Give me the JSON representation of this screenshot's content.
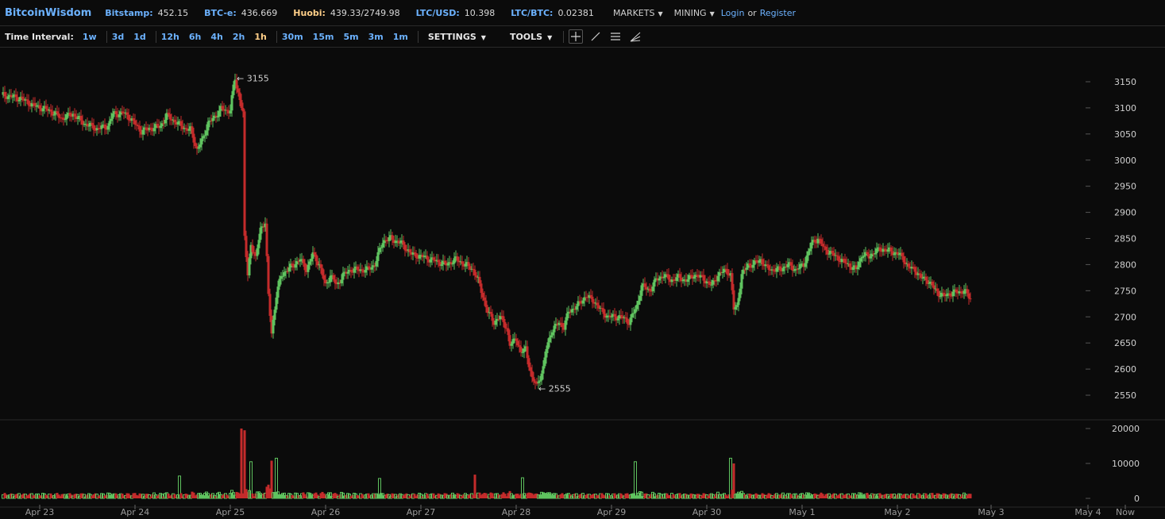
{
  "header": {
    "brand": "BitcoinWisdom",
    "tickers": [
      {
        "name": "Bitstamp:",
        "value": "452.15"
      },
      {
        "name": "BTC-e:",
        "value": "436.669"
      },
      {
        "name": "Huobi:",
        "value": "439.33/2749.98"
      },
      {
        "name": "LTC/USD:",
        "value": "10.398"
      },
      {
        "name": "LTC/BTC:",
        "value": "0.02381"
      }
    ],
    "markets_label": "MARKETS",
    "mining_label": "MINING",
    "login_label": "Login",
    "or_label": "or",
    "register_label": "Register"
  },
  "toolbar": {
    "time_interval_label": "Time Interval:",
    "intervals": [
      "1w",
      "3d",
      "1d",
      "12h",
      "6h",
      "4h",
      "2h",
      "1h",
      "30m",
      "15m",
      "5m",
      "3m",
      "1m"
    ],
    "active_interval": "1h",
    "settings_label": "SETTINGS",
    "tools_label": "TOOLS",
    "tool_icons": [
      "crosshair-icon",
      "line-draw-icon",
      "horizontal-lines-icon",
      "fan-draw-icon"
    ]
  },
  "colors": {
    "up": "#5fc35f",
    "down": "#c42b2b",
    "accent": "#6cb2ff",
    "highlight": "#ffcf88",
    "grid_text": "#cfcfcf"
  },
  "chart_data": {
    "type": "candlestick",
    "price_axis": {
      "ticks": [
        3150,
        3100,
        3050,
        3000,
        2950,
        2900,
        2850,
        2800,
        2750,
        2700,
        2650,
        2600,
        2550
      ],
      "range": [
        2535,
        3175
      ]
    },
    "volume_axis": {
      "ticks": [
        20000,
        10000,
        0
      ],
      "range": [
        0,
        20000
      ]
    },
    "x_labels": [
      "Apr 23",
      "Apr 24",
      "Apr 25",
      "Apr 26",
      "Apr 27",
      "Apr 28",
      "Apr 29",
      "Apr 30",
      "May 1",
      "May 2",
      "May 3",
      "May 4",
      "Now"
    ],
    "max_marker": {
      "label": "3155",
      "value": 3155
    },
    "min_marker": {
      "label": "2555",
      "value": 2555
    },
    "price_path": [
      [
        0,
        3125
      ],
      [
        12,
        3118
      ],
      [
        20,
        3105
      ],
      [
        30,
        3095
      ],
      [
        38,
        3080
      ],
      [
        45,
        3088
      ],
      [
        52,
        3070
      ],
      [
        60,
        3060
      ],
      [
        67,
        3065
      ],
      [
        70,
        3088
      ],
      [
        77,
        3090
      ],
      [
        81,
        3080
      ],
      [
        88,
        3055
      ],
      [
        93,
        3060
      ],
      [
        100,
        3065
      ],
      [
        104,
        3085
      ],
      [
        110,
        3072
      ],
      [
        116,
        3060
      ],
      [
        119,
        3058
      ],
      [
        123,
        3020
      ],
      [
        127,
        3042
      ],
      [
        130,
        3072
      ],
      [
        134,
        3080
      ],
      [
        138,
        3100
      ],
      [
        141,
        3092
      ],
      [
        144,
        3098
      ],
      [
        146,
        3142
      ],
      [
        147,
        3155
      ],
      [
        148,
        3135
      ],
      [
        150,
        3120
      ],
      [
        152,
        3090
      ],
      [
        153,
        2850
      ],
      [
        155,
        2780
      ],
      [
        157,
        2840
      ],
      [
        160,
        2810
      ],
      [
        163,
        2870
      ],
      [
        166,
        2880
      ],
      [
        168,
        2740
      ],
      [
        170,
        2670
      ],
      [
        173,
        2740
      ],
      [
        176,
        2780
      ],
      [
        180,
        2790
      ],
      [
        184,
        2800
      ],
      [
        188,
        2810
      ],
      [
        192,
        2790
      ],
      [
        196,
        2820
      ],
      [
        200,
        2800
      ],
      [
        204,
        2760
      ],
      [
        207,
        2780
      ],
      [
        211,
        2760
      ],
      [
        215,
        2780
      ],
      [
        220,
        2790
      ],
      [
        225,
        2790
      ],
      [
        230,
        2790
      ],
      [
        235,
        2800
      ],
      [
        240,
        2845
      ],
      [
        245,
        2850
      ],
      [
        252,
        2840
      ],
      [
        258,
        2820
      ],
      [
        265,
        2815
      ],
      [
        270,
        2810
      ],
      [
        275,
        2805
      ],
      [
        280,
        2800
      ],
      [
        286,
        2810
      ],
      [
        292,
        2800
      ],
      [
        297,
        2790
      ],
      [
        300,
        2770
      ],
      [
        303,
        2740
      ],
      [
        306,
        2710
      ],
      [
        310,
        2690
      ],
      [
        314,
        2700
      ],
      [
        318,
        2680
      ],
      [
        320,
        2645
      ],
      [
        324,
        2660
      ],
      [
        327,
        2630
      ],
      [
        330,
        2640
      ],
      [
        334,
        2580
      ],
      [
        337,
        2570
      ],
      [
        341,
        2600
      ],
      [
        343,
        2640
      ],
      [
        346,
        2670
      ],
      [
        351,
        2690
      ],
      [
        354,
        2680
      ],
      [
        357,
        2710
      ],
      [
        362,
        2720
      ],
      [
        368,
        2740
      ],
      [
        373,
        2730
      ],
      [
        378,
        2710
      ],
      [
        382,
        2700
      ],
      [
        386,
        2700
      ],
      [
        390,
        2700
      ],
      [
        395,
        2690
      ],
      [
        400,
        2720
      ],
      [
        403,
        2760
      ],
      [
        408,
        2750
      ],
      [
        412,
        2770
      ],
      [
        417,
        2780
      ],
      [
        421,
        2770
      ],
      [
        426,
        2775
      ],
      [
        431,
        2770
      ],
      [
        436,
        2780
      ],
      [
        441,
        2775
      ],
      [
        447,
        2760
      ],
      [
        451,
        2780
      ],
      [
        456,
        2790
      ],
      [
        459,
        2780
      ],
      [
        461,
        2715
      ],
      [
        463,
        2720
      ],
      [
        466,
        2780
      ],
      [
        470,
        2800
      ],
      [
        473,
        2800
      ],
      [
        478,
        2810
      ],
      [
        481,
        2795
      ],
      [
        485,
        2790
      ],
      [
        490,
        2790
      ],
      [
        495,
        2800
      ],
      [
        500,
        2790
      ],
      [
        505,
        2800
      ],
      [
        510,
        2840
      ],
      [
        514,
        2850
      ],
      [
        518,
        2830
      ],
      [
        523,
        2820
      ],
      [
        528,
        2810
      ],
      [
        533,
        2800
      ],
      [
        538,
        2790
      ],
      [
        542,
        2820
      ],
      [
        546,
        2815
      ],
      [
        550,
        2825
      ],
      [
        555,
        2830
      ],
      [
        560,
        2825
      ],
      [
        565,
        2820
      ],
      [
        568,
        2810
      ],
      [
        571,
        2795
      ],
      [
        575,
        2790
      ],
      [
        579,
        2775
      ],
      [
        583,
        2770
      ],
      [
        587,
        2755
      ],
      [
        590,
        2745
      ],
      [
        593,
        2740
      ],
      [
        598,
        2745
      ],
      [
        603,
        2748
      ],
      [
        606,
        2750
      ],
      [
        610,
        2735
      ]
    ],
    "volume_spikes": [
      [
        151,
        20000
      ],
      [
        153,
        19500
      ],
      [
        157,
        10500
      ],
      [
        170,
        10800
      ],
      [
        173,
        11500
      ],
      [
        399,
        10500
      ],
      [
        459,
        11500
      ],
      [
        461,
        10000
      ],
      [
        298,
        6800
      ],
      [
        112,
        6400
      ],
      [
        238,
        5700
      ],
      [
        328,
        5900
      ]
    ]
  }
}
